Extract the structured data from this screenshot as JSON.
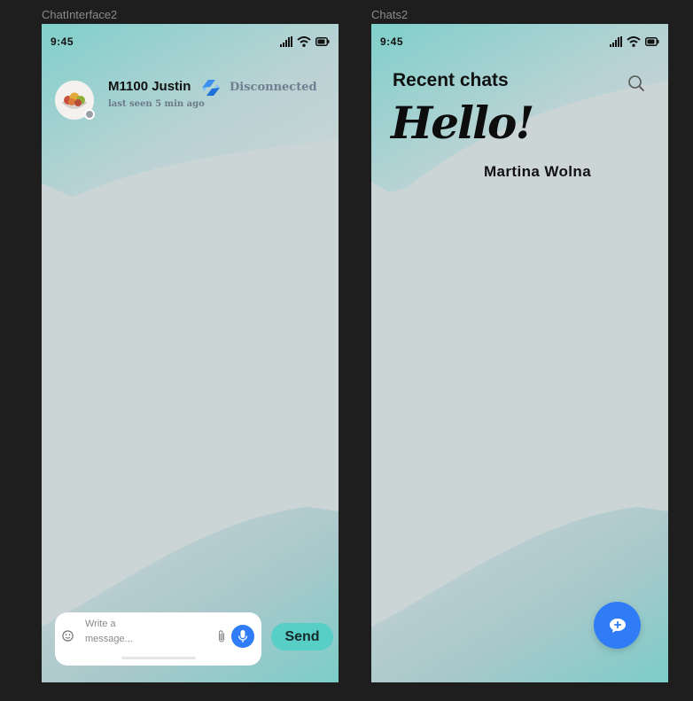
{
  "frames": [
    {
      "label": "ChatInterface2"
    },
    {
      "label": "Chats2"
    }
  ],
  "chat_interface": {
    "status_bar": {
      "time": "9:45",
      "icons": [
        "signal-icon",
        "wifi-icon",
        "battery-icon"
      ]
    },
    "header": {
      "contact_name": "M1100 Justin",
      "last_seen": "last seen 5 min ago",
      "connection_status": "Disconnected",
      "connection_icon": "sync-icon"
    },
    "composer": {
      "placeholder": "Write a message...",
      "icons": [
        "emoji-icon",
        "paperclip-icon",
        "microphone-icon"
      ],
      "send_label": "Send"
    }
  },
  "chats": {
    "status_bar": {
      "time": "9:45",
      "icons": [
        "signal-icon",
        "wifi-icon",
        "battery-icon"
      ]
    },
    "title": "Recent chats",
    "greeting": "Hello!",
    "user_name": "Martina Wolna",
    "search_icon": "search-icon",
    "new_chat_icon": "chat-plus-icon"
  },
  "colors": {
    "canvas": "#1e1e1e",
    "screen_base": "#ccd5d6",
    "teal_accent": "#7ccfca",
    "send_button": "#57cec6",
    "primary_blue": "#2f7cf6",
    "status_text": "#6f7f91"
  }
}
